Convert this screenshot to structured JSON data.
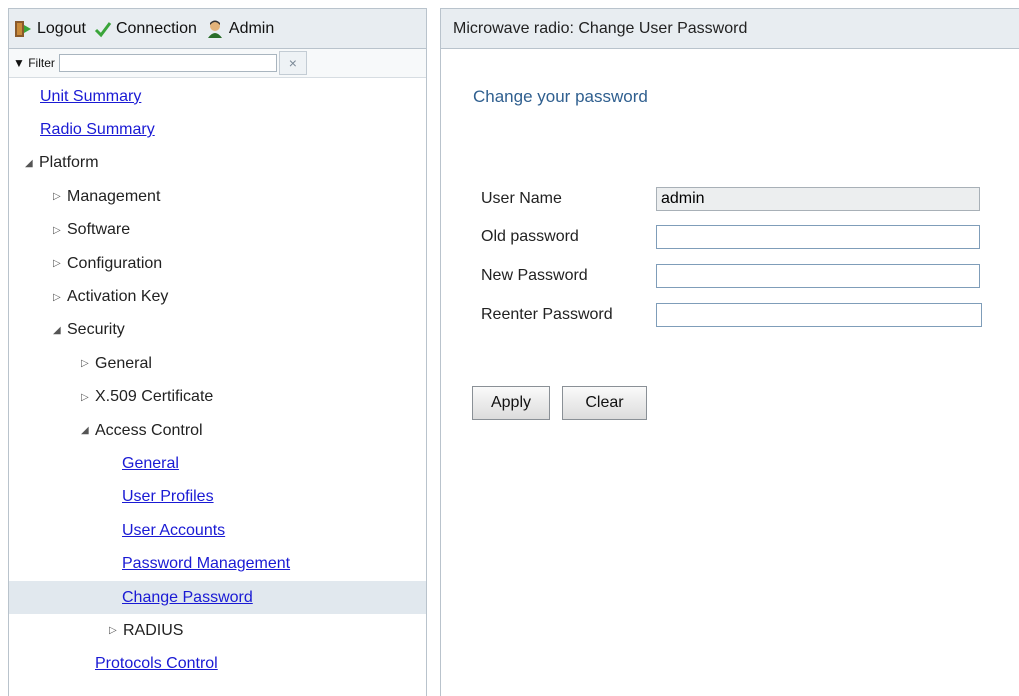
{
  "topbar": {
    "logout_label": "Logout",
    "connection_label": "Connection",
    "admin_label": "Admin"
  },
  "filter": {
    "label": "Filter",
    "value": "",
    "clear_symbol": "×"
  },
  "tree": {
    "unit_summary": "Unit Summary",
    "radio_summary": "Radio Summary",
    "platform": "Platform",
    "management": "Management",
    "software": "Software",
    "configuration": "Configuration",
    "activation_key": "Activation Key",
    "security": "Security",
    "general": "General",
    "x509": "X.509 Certificate",
    "access_control": "Access Control",
    "ac_general": "General",
    "user_profiles": "User Profiles",
    "user_accounts": "User Accounts",
    "password_management": "Password Management",
    "change_password": "Change Password",
    "radius": "RADIUS",
    "protocols_control": "Protocols Control"
  },
  "page": {
    "header": "Microwave radio: Change User Password",
    "subtitle": "Change your password"
  },
  "form": {
    "user_name_label": "User Name",
    "user_name_value": "admin",
    "old_password_label": "Old password",
    "new_password_label": "New Password",
    "reenter_password_label": "Reenter Password"
  },
  "buttons": {
    "apply": "Apply",
    "clear": "Clear"
  },
  "colors": {
    "link": "#1a1ad4",
    "subtitle": "#2f5f8f",
    "header_bg": "#e8edf1",
    "selected_bg": "#e1e8ee"
  },
  "icons": {
    "logout": "door-exit-icon",
    "connection": "checkmark-icon",
    "admin": "user-icon"
  }
}
